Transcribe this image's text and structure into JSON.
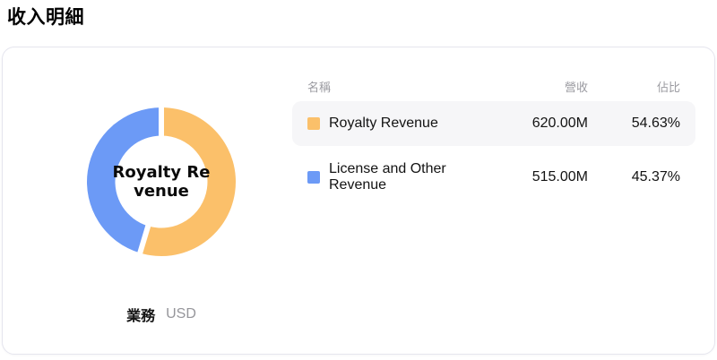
{
  "page": {
    "title": "收入明細"
  },
  "panel": {
    "caption_bold": "業務",
    "caption_sub": "USD",
    "center_label_line1": "Royalty Re",
    "center_label_line2": "venue"
  },
  "table": {
    "headers": {
      "name": "名稱",
      "revenue": "營收",
      "share": "佔比"
    },
    "rows": [
      {
        "name": "Royalty Revenue",
        "revenue": "620.00M",
        "share": "54.63%",
        "color": "#FBC06A"
      },
      {
        "name": "License and Other Revenue",
        "revenue": "515.00M",
        "share": "45.37%",
        "color": "#6C9AF6"
      }
    ]
  },
  "chart_data": {
    "type": "pie",
    "donut": true,
    "title": "收入明細",
    "caption": "業務 USD",
    "categories": [
      "Royalty Revenue",
      "License and Other Revenue"
    ],
    "values": [
      620.0,
      515.0
    ],
    "value_unit": "M USD",
    "value_labels": [
      "620.00M",
      "515.00M"
    ],
    "percentages": [
      54.63,
      45.37
    ],
    "colors": [
      "#FBC06A",
      "#6C9AF6"
    ],
    "start_angle_deg": 0,
    "clockwise": true,
    "center_label": "Royalty Revenue",
    "legend_position": "right-table",
    "separator_color": "#ffffff"
  }
}
